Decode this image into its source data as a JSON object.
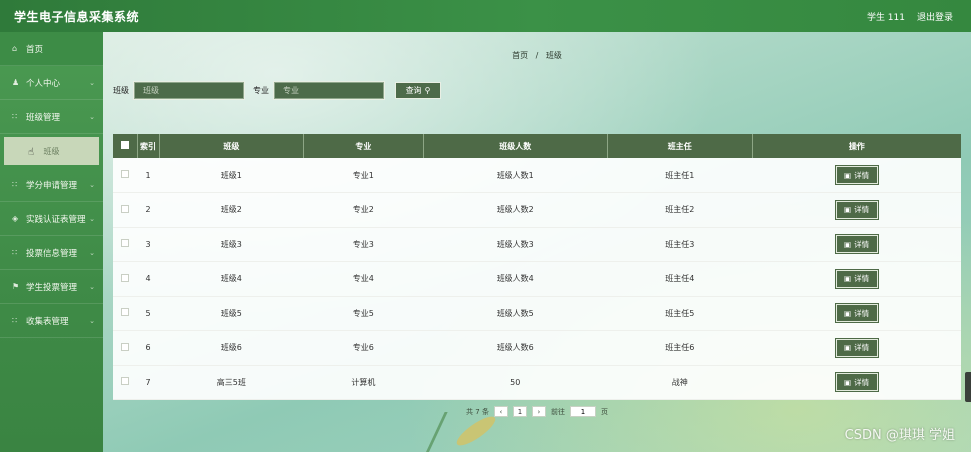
{
  "header": {
    "title": "学生电子信息采集系统",
    "user_label": "学生 111",
    "logout_label": "退出登录"
  },
  "sidebar": {
    "items": [
      {
        "label": "首页",
        "icon": "home-icon",
        "glyph": "⌂",
        "chevron": false
      },
      {
        "label": "个人中心",
        "icon": "user-icon",
        "glyph": "♟",
        "chevron": true
      },
      {
        "label": "班级管理",
        "icon": "grid-icon",
        "glyph": "∷",
        "chevron": true
      },
      {
        "label": "学分申请管理",
        "icon": "grid-icon",
        "glyph": "∷",
        "chevron": true
      },
      {
        "label": "实践认证表管理",
        "icon": "shield-icon",
        "glyph": "◈",
        "chevron": true
      },
      {
        "label": "投票信息管理",
        "icon": "grid-icon",
        "glyph": "∷",
        "chevron": true
      },
      {
        "label": "学生投票管理",
        "icon": "flag-icon",
        "glyph": "⚑",
        "chevron": true
      },
      {
        "label": "收集表管理",
        "icon": "grid-icon",
        "glyph": "∷",
        "chevron": true
      }
    ],
    "submenu_label": "班级"
  },
  "breadcrumb": {
    "home": "首页",
    "sep": "/",
    "current": "班级"
  },
  "search": {
    "class_label": "班级",
    "class_placeholder": "班级",
    "major_label": "专业",
    "major_placeholder": "专业",
    "query_label": "查询",
    "query_icon": "search-icon"
  },
  "table": {
    "headers": [
      "索引",
      "班级",
      "专业",
      "班级人数",
      "班主任",
      "操作"
    ],
    "rows": [
      {
        "idx": "1",
        "class": "班级1",
        "major": "专业1",
        "count": "班级人数1",
        "teacher": "班主任1"
      },
      {
        "idx": "2",
        "class": "班级2",
        "major": "专业2",
        "count": "班级人数2",
        "teacher": "班主任2"
      },
      {
        "idx": "3",
        "class": "班级3",
        "major": "专业3",
        "count": "班级人数3",
        "teacher": "班主任3"
      },
      {
        "idx": "4",
        "class": "班级4",
        "major": "专业4",
        "count": "班级人数4",
        "teacher": "班主任4"
      },
      {
        "idx": "5",
        "class": "班级5",
        "major": "专业5",
        "count": "班级人数5",
        "teacher": "班主任5"
      },
      {
        "idx": "6",
        "class": "班级6",
        "major": "专业6",
        "count": "班级人数6",
        "teacher": "班主任6"
      },
      {
        "idx": "7",
        "class": "高三5班",
        "major": "计算机",
        "count": "50",
        "teacher": "战神"
      }
    ],
    "detail_label": "详情"
  },
  "pager": {
    "total": "共 7 条",
    "prev": "‹",
    "current_page": "1",
    "next": "›",
    "goto_label": "前往",
    "goto_value": "1",
    "page_suffix": "页"
  },
  "watermark": "CSDN @琪琪 学姐"
}
